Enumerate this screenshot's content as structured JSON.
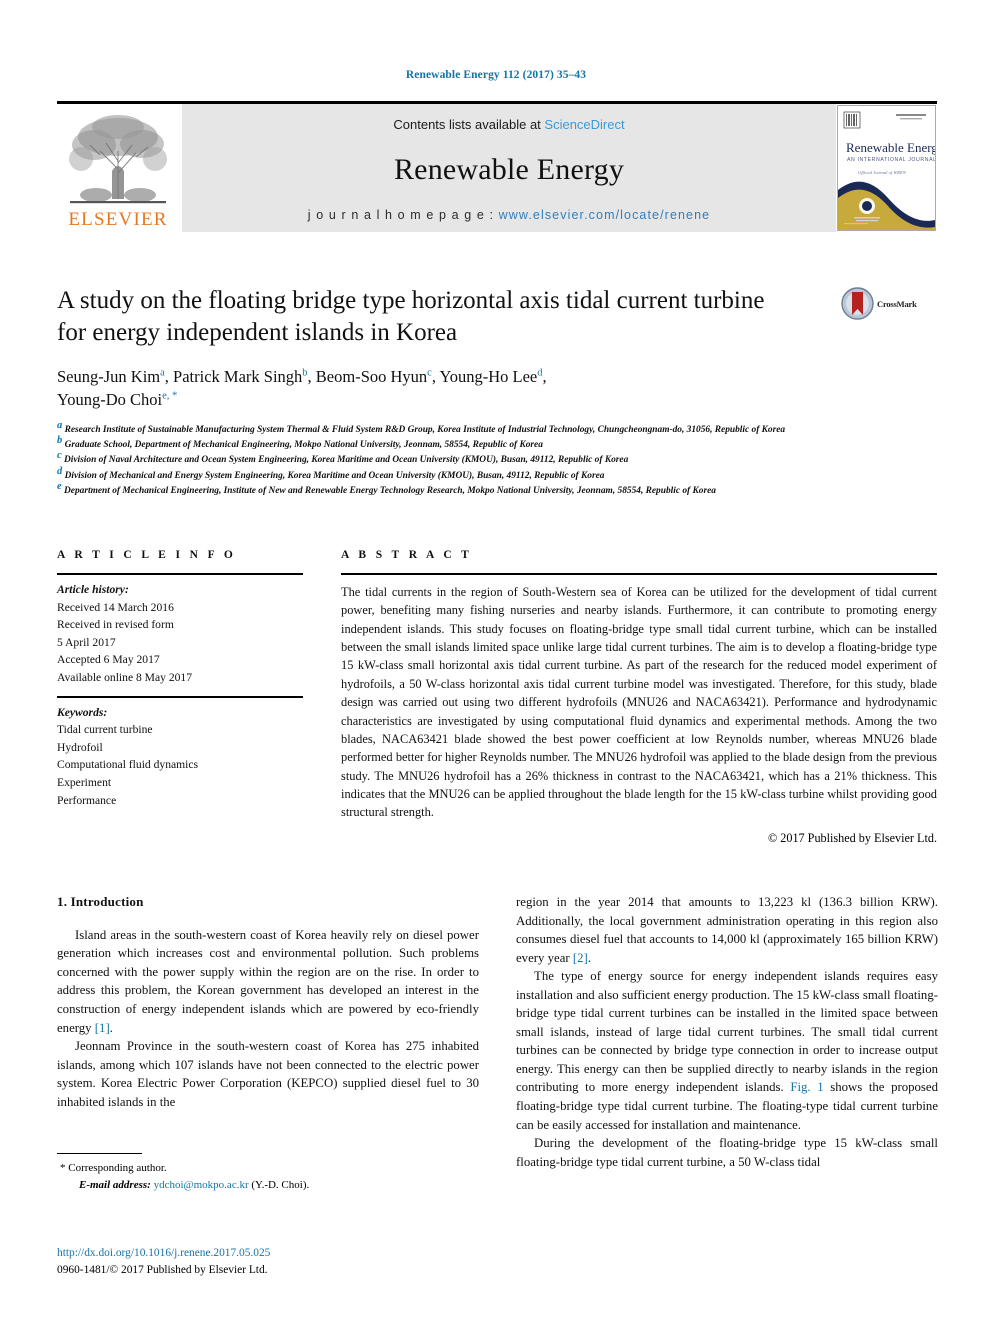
{
  "running_head": "Renewable Energy 112 (2017) 35–43",
  "masthead": {
    "publisher_name": "ELSEVIER",
    "contents_prefix": "Contents lists available at ",
    "contents_link": "ScienceDirect",
    "journal_name": "Renewable Energy",
    "homepage_prefix": "j o u r n a l   h o m e p a g e :   ",
    "homepage_url": "www.elsevier.com/locate/renene",
    "cover": {
      "title": "Renewable Energy",
      "subtitle": "AN INTERNATIONAL JOURNAL",
      "tagline": "Official Journal of WREN"
    }
  },
  "article": {
    "title": "A study on the floating bridge type horizontal axis tidal current turbine for energy independent islands in Korea",
    "crossmark_label": "CrossMark",
    "authors": [
      {
        "name": "Seung-Jun Kim",
        "sup": "a",
        "sep": ", "
      },
      {
        "name": "Patrick Mark Singh",
        "sup": "b",
        "sep": ", "
      },
      {
        "name": "Beom-Soo Hyun",
        "sup": "c",
        "sep": ", "
      },
      {
        "name": "Young-Ho Lee",
        "sup": "d",
        "sep": ", "
      },
      {
        "name": "Young-Do Choi",
        "sup": "e, *",
        "sep": ""
      }
    ],
    "affiliations": [
      {
        "marker": "a",
        "text": "Research Institute of Sustainable Manufacturing System Thermal & Fluid System R&D Group, Korea Institute of Industrial Technology, Chungcheongnam-do, 31056, Republic of Korea"
      },
      {
        "marker": "b",
        "text": "Graduate School, Department of Mechanical Engineering, Mokpo National University, Jeonnam, 58554, Republic of Korea"
      },
      {
        "marker": "c",
        "text": "Division of Naval Architecture and Ocean System Engineering, Korea Maritime and Ocean University (KMOU), Busan, 49112, Republic of Korea"
      },
      {
        "marker": "d",
        "text": "Division of Mechanical and Energy System Engineering, Korea Maritime and Ocean University (KMOU), Busan, 49112, Republic of Korea"
      },
      {
        "marker": "e",
        "text": "Department of Mechanical Engineering, Institute of New and Renewable Energy Technology Research, Mokpo National University, Jeonnam, 58554, Republic of Korea"
      }
    ]
  },
  "article_info": {
    "heading": "A R T I C L E   I N F O",
    "history_label": "Article history:",
    "history": [
      "Received 14 March 2016",
      "Received in revised form",
      "5 April 2017",
      "Accepted 6 May 2017",
      "Available online 8 May 2017"
    ],
    "keywords_label": "Keywords:",
    "keywords": [
      "Tidal current turbine",
      "Hydrofoil",
      "Computational fluid dynamics",
      "Experiment",
      "Performance"
    ]
  },
  "abstract": {
    "heading": "A B S T R A C T",
    "text": "The tidal currents in the region of South-Western sea of Korea can be utilized for the development of tidal current power, benefiting many fishing nurseries and nearby islands. Furthermore, it can contribute to promoting energy independent islands. This study focuses on floating-bridge type small tidal current turbine, which can be installed between the small islands limited space unlike large tidal current turbines. The aim is to develop a floating-bridge type 15 kW-class small horizontal axis tidal current turbine. As part of the research for the reduced model experiment of hydrofoils, a 50 W-class horizontal axis tidal current turbine model was investigated. Therefore, for this study, blade design was carried out using two different hydrofoils (MNU26 and NACA63421). Performance and hydrodynamic characteristics are investigated by using computational fluid dynamics and experimental methods. Among the two blades, NACA63421 blade showed the best power coefficient at low Reynolds number, whereas MNU26 blade performed better for higher Reynolds number. The MNU26 hydrofoil was applied to the blade design from the previous study. The MNU26 hydrofoil has a 26% thickness in contrast to the NACA63421, which has a 21% thickness. This indicates that the MNU26 can be applied throughout the blade length for the 15 kW-class turbine whilst providing good structural strength.",
    "copyright": "© 2017 Published by Elsevier Ltd."
  },
  "body": {
    "section_number_title": "1.  Introduction",
    "left_paragraphs": [
      "Island areas in the south-western coast of Korea heavily rely on diesel power generation which increases cost and environmental pollution. Such problems concerned with the power supply within the region are on the rise. In order to address this problem, the Korean government has developed an interest in the construction of energy independent islands which are powered by eco-friendly energy ",
      "Jeonnam Province in the south-western coast of Korea has 275 inhabited islands, among which 107 islands have not been connected to the electric power system. Korea Electric Power Corporation (KEPCO) supplied diesel fuel to 30 inhabited islands in the"
    ],
    "left_ref_1": "[1]",
    "left_ref_1_tail": ".",
    "right_paragraphs": [
      "region in the year 2014 that amounts to 13,223 kl (136.3 billion KRW). Additionally, the local government administration operating in this region also consumes diesel fuel that accounts to 14,000 kl (approximately 165 billion KRW) every year ",
      "The type of energy source for energy independent islands requires easy installation and also sufficient energy production. The 15 kW-class small floating-bridge type tidal current turbines can be installed in the limited space between small islands, instead of large tidal current turbines. The small tidal current turbines can be connected by bridge type connection in order to increase output energy. This energy can then be supplied directly to nearby islands in the region contributing to more energy independent islands. ",
      "During the development of the floating-bridge type 15 kW-class small floating-bridge type tidal current turbine, a 50 W-class tidal"
    ],
    "right_ref_2": "[2]",
    "right_ref_2_tail": ".",
    "right_fig_ref": "Fig. 1",
    "right_fig_tail": " shows the proposed floating-bridge type tidal current turbine. The floating-type tidal current turbine can be easily accessed for installation and maintenance."
  },
  "footnote": {
    "star": "*",
    "corresponding": "Corresponding author.",
    "email_label": "E-mail address:",
    "email": "ydchoi@mokpo.ac.kr",
    "email_tail": "(Y.-D. Choi)."
  },
  "doi": {
    "url": "http://dx.doi.org/10.1016/j.renene.2017.05.025",
    "issn_line": "0960-1481/© 2017 Published by Elsevier Ltd."
  },
  "colors": {
    "link_blue": "#1573a8",
    "sciencedirect_blue": "#3a9ad9",
    "elsevier_orange": "#e87722",
    "masthead_gray": "#e6e6e6"
  }
}
